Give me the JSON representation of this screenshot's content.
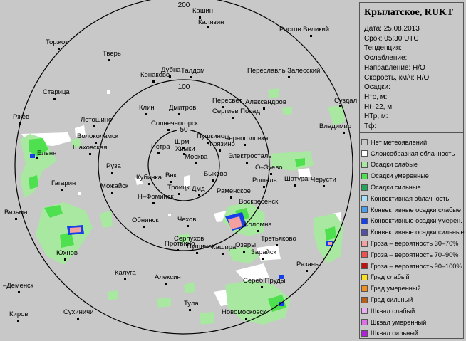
{
  "panel": {
    "title": "Крылатское, RUKT",
    "lines": [
      "Дата: 25.08.2013",
      "Срок: 05:30 UTC",
      "Тенденция:",
      "Ослабление:",
      "Направление: Н/О",
      "Скорость, км/ч: Н/О",
      "Осадки:",
      "Hто, м:",
      "Ht–22, м:",
      "HТр, м:",
      "Тф:"
    ]
  },
  "legend": [
    {
      "label": "Нет метеоявлений",
      "color": "#c8c8c8"
    },
    {
      "label": "Слоисобразная облачность",
      "color": "#ffffff"
    },
    {
      "label": "Осадки слабые",
      "color": "#a8e8a0"
    },
    {
      "label": "Осадки умеренные",
      "color": "#4ee04e"
    },
    {
      "label": "Осадки сильные",
      "color": "#22a85a"
    },
    {
      "label": "Конвективная облачность",
      "color": "#a8e0f8"
    },
    {
      "label": "Конвективные осадки слабые",
      "color": "#4aa0f0"
    },
    {
      "label": "Конвективные осадки умерен.",
      "color": "#1840e8"
    },
    {
      "label": "Конвективные осадки сильные",
      "color": "#5050a8"
    },
    {
      "label": "Гроза – вероятность 30–70%",
      "color": "#f4a0a0"
    },
    {
      "label": "Гроза – вероятность 70–90%",
      "color": "#f05050"
    },
    {
      "label": "Гроза – вероятность 90–100%",
      "color": "#c01010"
    },
    {
      "label": "Град слабый",
      "color": "#f8e020"
    },
    {
      "label": "Град умеренный",
      "color": "#f09020"
    },
    {
      "label": "Град сильный",
      "color": "#b86018"
    },
    {
      "label": "Шквал слабый",
      "color": "#e8b0f0"
    },
    {
      "label": "Шквал умеренный",
      "color": "#e070e8"
    },
    {
      "label": "Шквал сильный",
      "color": "#b020d8"
    }
  ],
  "map": {
    "rings": [
      {
        "label": "50",
        "range_km": 50
      },
      {
        "label": "100",
        "range_km": 100
      },
      {
        "label": "200",
        "range_km": 200
      }
    ],
    "cities": [
      {
        "name": "Кашин"
      },
      {
        "name": "Калязин"
      },
      {
        "name": "Ростов Великий"
      },
      {
        "name": "Торжок"
      },
      {
        "name": "Тверь"
      },
      {
        "name": "Дубна"
      },
      {
        "name": "Талдом"
      },
      {
        "name": "Конаково"
      },
      {
        "name": "Переславль Залесский"
      },
      {
        "name": "Старица"
      },
      {
        "name": "Суздаль"
      },
      {
        "name": "Пересвет"
      },
      {
        "name": "Александров"
      },
      {
        "name": "Клин"
      },
      {
        "name": "Дмитров"
      },
      {
        "name": "Сергиев Посад"
      },
      {
        "name": "Ржев"
      },
      {
        "name": "Лотошино"
      },
      {
        "name": "Солнечногорск"
      },
      {
        "name": "Владимир"
      },
      {
        "name": "Волоколамск"
      },
      {
        "name": "Пушкино"
      },
      {
        "name": "Черноголовка"
      },
      {
        "name": "Шрм"
      },
      {
        "name": "Фрязино"
      },
      {
        "name": "Ельня"
      },
      {
        "name": "Шаховская"
      },
      {
        "name": "Истра"
      },
      {
        "name": "Химки"
      },
      {
        "name": "Электросталь"
      },
      {
        "name": "Москва"
      },
      {
        "name": "Руза"
      },
      {
        "name": "О–Зуево"
      },
      {
        "name": "Черусти"
      },
      {
        "name": "Быково"
      },
      {
        "name": "Кубинка"
      },
      {
        "name": "Внк"
      },
      {
        "name": "Шатура"
      },
      {
        "name": "Гагарин"
      },
      {
        "name": "Рошаль"
      },
      {
        "name": "Можайск"
      },
      {
        "name": "Троицк"
      },
      {
        "name": "Дмд"
      },
      {
        "name": "Раменское"
      },
      {
        "name": "Н–Фоминск"
      },
      {
        "name": "Вязьма"
      },
      {
        "name": "Воскресенск"
      },
      {
        "name": "Обнинск"
      },
      {
        "name": "Чехов"
      },
      {
        "name": "Коломна"
      },
      {
        "name": "Серпухов"
      },
      {
        "name": "Протвино"
      },
      {
        "name": "Пущино"
      },
      {
        "name": "Третьяково"
      },
      {
        "name": "Кашира"
      },
      {
        "name": "Озеры"
      },
      {
        "name": "Юхнов"
      },
      {
        "name": "Зарайск"
      },
      {
        "name": "Рязань"
      },
      {
        "name": "Калуга"
      },
      {
        "name": "Алексин"
      },
      {
        "name": "Сереб.Пруды"
      },
      {
        "name": "–Деменск"
      },
      {
        "name": "Тула"
      },
      {
        "name": "Новомосковск"
      },
      {
        "name": "Киров"
      },
      {
        "name": "Сухиничи"
      }
    ]
  }
}
